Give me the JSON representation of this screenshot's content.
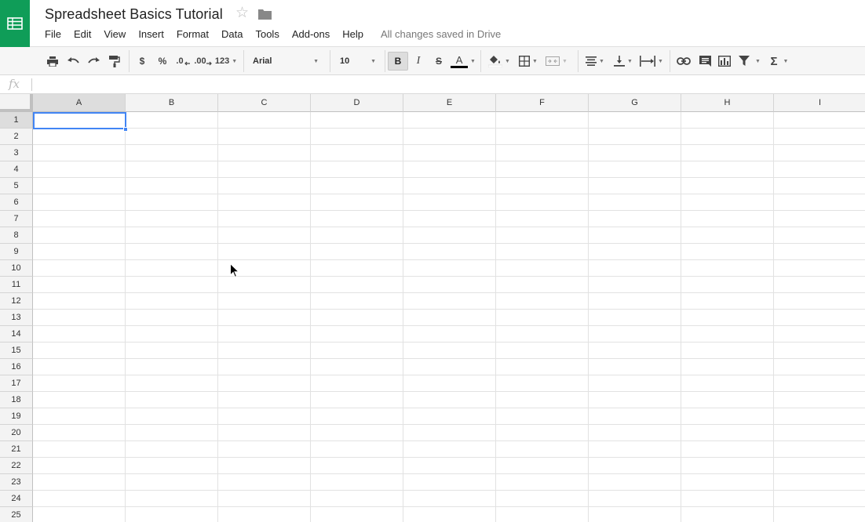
{
  "app": {
    "title": "Spreadsheet Basics Tutorial",
    "save_status": "All changes saved in Drive",
    "brand_color": "#0f9d58"
  },
  "menu": {
    "items": [
      "File",
      "Edit",
      "View",
      "Insert",
      "Format",
      "Data",
      "Tools",
      "Add-ons",
      "Help"
    ]
  },
  "toolbar": {
    "currency_label": "$",
    "percent_label": "%",
    "decrease_decimal_label": ".0",
    "increase_decimal_label": ".00",
    "more_formats_label": "123",
    "font_family": "Arial",
    "font_size": "10",
    "bold_label": "B",
    "italic_label": "I",
    "strikethrough_label": "S",
    "text_color_label": "A",
    "functions_label": "Σ"
  },
  "formula_bar": {
    "fx_label": "fx",
    "value": ""
  },
  "grid": {
    "columns": [
      "A",
      "B",
      "C",
      "D",
      "E",
      "F",
      "G",
      "H",
      "I"
    ],
    "rows": [
      "1",
      "2",
      "3",
      "4",
      "5",
      "6",
      "7",
      "8",
      "9",
      "10",
      "11",
      "12",
      "13",
      "14",
      "15",
      "16",
      "17",
      "18",
      "19",
      "20",
      "21",
      "22",
      "23",
      "24",
      "25"
    ],
    "active_cell": "A1",
    "selection_color": "#4285f4"
  }
}
